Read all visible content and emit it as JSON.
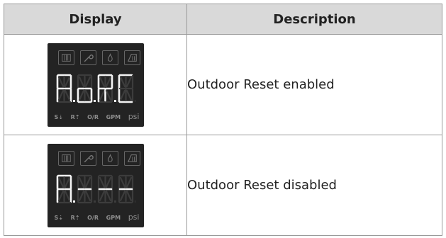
{
  "table": {
    "headers": [
      "Display",
      "Description"
    ],
    "rows": [
      {
        "display": {
          "digits": [
            {
              "on": [
                "a",
                "b",
                "c",
                "e",
                "f",
                "g1",
                "g2"
              ],
              "dot": true
            },
            {
              "on": [
                "c",
                "d",
                "e",
                "g1",
                "g2"
              ],
              "dot": true
            },
            {
              "on": [
                "a",
                "b",
                "e",
                "f",
                "g1",
                "g2",
                "l"
              ],
              "dot": true
            },
            {
              "on": [
                "a",
                "d",
                "e",
                "f"
              ],
              "dot": false
            }
          ],
          "labels": [
            "S⇣",
            "R⇡",
            "O/R",
            "GPM",
            "psi"
          ]
        },
        "description": "Outdoor Reset enabled"
      },
      {
        "display": {
          "digits": [
            {
              "on": [
                "a",
                "b",
                "c",
                "e",
                "f",
                "g1",
                "g2"
              ],
              "dot": true
            },
            {
              "on": [
                "g1",
                "g2"
              ],
              "dot": false
            },
            {
              "on": [
                "g1",
                "g2"
              ],
              "dot": false
            },
            {
              "on": [
                "g1",
                "g2"
              ],
              "dot": false
            }
          ],
          "labels": [
            "S⇣",
            "R⇡",
            "O/R",
            "GPM",
            "psi"
          ]
        },
        "description": "Outdoor Reset disabled"
      }
    ]
  },
  "colors": {
    "panel": "#232323",
    "segment_on": "#f4f4f4",
    "segment_off": "#3c3c3c",
    "icon_outline": "#666666",
    "header_bg": "#d9d9d9"
  },
  "icons": [
    "boiler-icon",
    "wrench-icon",
    "flame-icon",
    "water-heater-icon"
  ]
}
